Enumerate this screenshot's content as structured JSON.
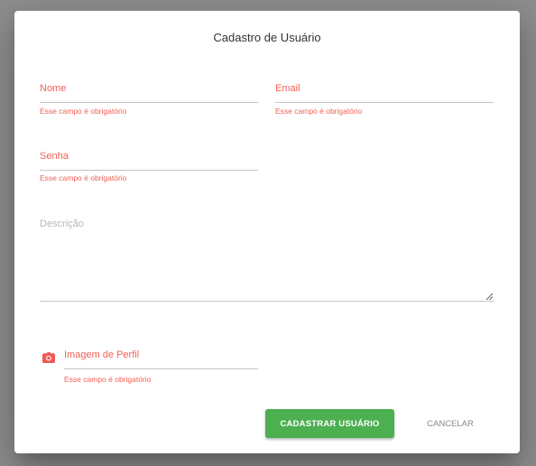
{
  "dialog": {
    "title": "Cadastro de Usuário",
    "fields": {
      "name": {
        "label": "Nome",
        "value": "",
        "error": "Esse campo é obrigatório"
      },
      "email": {
        "label": "Email",
        "value": "",
        "error": "Esse campo é obrigatório"
      },
      "password": {
        "label": "Senha",
        "value": "",
        "error": "Esse campo é obrigatório"
      },
      "description": {
        "label": "Descrição",
        "value": ""
      },
      "profile_image": {
        "label": "Imagem de Perfil",
        "value": "",
        "error": "Esse campo é obrigatório",
        "icon": "camera-icon"
      }
    },
    "actions": {
      "submit_label": "CADASTRAR USUÁRIO",
      "cancel_label": "CANCELAR"
    }
  },
  "colors": {
    "error": "#f44336",
    "primary_button": "#4caf50",
    "backdrop": "#8e8e8e"
  }
}
